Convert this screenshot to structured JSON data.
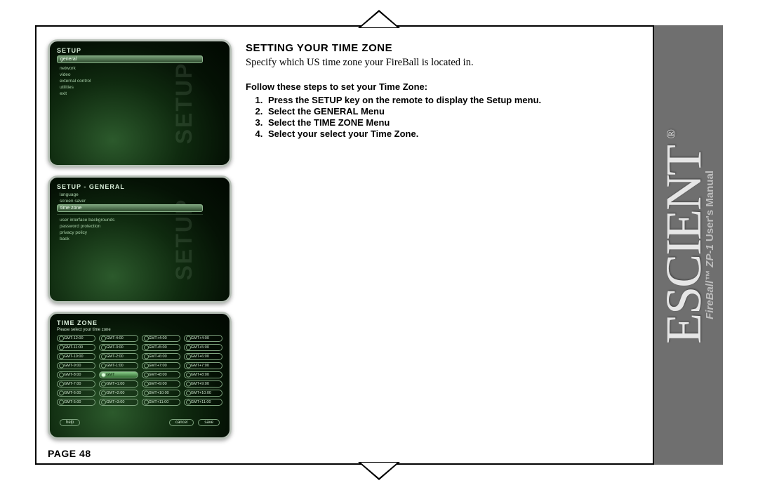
{
  "page_label": "PAGE 48",
  "brand": {
    "logo": "ESCIENT",
    "registered": "®",
    "subtitle_bold": "FireBall™ ZP-1",
    "subtitle_rest": " User's Manual"
  },
  "text": {
    "heading": "SETTING YOUR TIME ZONE",
    "description": "Specify which US time zone your FireBall is located in.",
    "steps_lead": "Follow these steps to set your Time Zone:",
    "steps": [
      "Press the SETUP key on the remote to display the Setup menu.",
      "Select the GENERAL Menu",
      "Select the TIME ZONE Menu",
      "Select your select your Time Zone."
    ]
  },
  "screens": {
    "watermark": "SETUP",
    "s1": {
      "title": "SETUP",
      "highlight": "general",
      "items": [
        "network",
        "video",
        "external control",
        "utilities",
        "exit"
      ]
    },
    "s2": {
      "title": "SETUP - GENERAL",
      "items_top": [
        "language",
        "screen saver"
      ],
      "highlight": "time zone",
      "items_bottom": [
        "user interface backgrounds",
        "password protection",
        "privacy policy",
        "back"
      ]
    },
    "s3": {
      "title": "TIME ZONE",
      "prompt": "Please select your time zone",
      "options": [
        "GMT-12:00",
        "GMT-4:00",
        "GMT+4:00",
        "GMT+4:00",
        "GMT-11:00",
        "GMT-3:00",
        "GMT+5:00",
        "GMT+5:00",
        "GMT-10:00",
        "GMT-2:00",
        "GMT+6:00",
        "GMT+6:00",
        "GMT-9:00",
        "GMT-1:00",
        "GMT+7:00",
        "GMT+7:00",
        "GMT-8:00",
        "GMT",
        "GMT+8:00",
        "GMT+8:00",
        "GMT-7:00",
        "GMT+1:00",
        "GMT+9:00",
        "GMT+9:00",
        "GMT-6:00",
        "GMT+2:00",
        "GMT+10:00",
        "GMT+10:00",
        "GMT-5:00",
        "GMT+3:00",
        "GMT+11:00",
        "GMT+11:00"
      ],
      "selected_index": 17,
      "buttons": {
        "help": "help",
        "cancel": "cancel",
        "save": "save"
      }
    }
  }
}
